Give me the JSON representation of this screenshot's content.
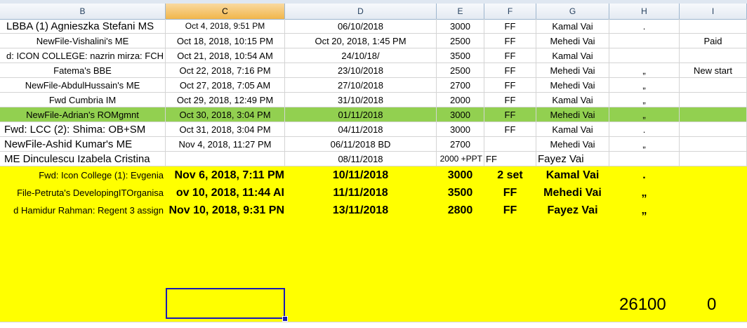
{
  "columns": [
    {
      "letter": "B",
      "active": false
    },
    {
      "letter": "C",
      "active": true
    },
    {
      "letter": "D",
      "active": false
    },
    {
      "letter": "E",
      "active": false
    },
    {
      "letter": "F",
      "active": false
    },
    {
      "letter": "G",
      "active": false
    },
    {
      "letter": "H",
      "active": false
    },
    {
      "letter": "I",
      "active": false
    }
  ],
  "rows": [
    {
      "b": "LBBA (1) Agnieszka Stefani MS",
      "c": "Oct 4, 2018, 9:51 PM",
      "d": "06/10/2018",
      "e": "3000",
      "f": "FF",
      "g": "Kamal Vai",
      "h": ".",
      "i": ""
    },
    {
      "b": "NewFile-Vishalini's ME",
      "c": "Oct 18, 2018, 10:15 PM",
      "d": "Oct 20, 2018, 1:45 PM",
      "e": "2500",
      "f": "FF",
      "g": "Mehedi Vai",
      "h": "",
      "i": "Paid"
    },
    {
      "b": "d: ICON COLLEGE: nazrin mirza: FCH",
      "c": "Oct 21, 2018, 10:54 AM",
      "d": "24/10/18/",
      "e": "3500",
      "f": "FF",
      "g": "Kamal Vai",
      "h": "",
      "i": ""
    },
    {
      "b": "Fatema's BBE",
      "c": "Oct 22, 2018, 7:16 PM",
      "d": "23/10/2018",
      "e": "2500",
      "f": "FF",
      "g": "Mehedi Vai",
      "h": "„",
      "i": "New start"
    },
    {
      "b": "NewFile-AbdulHussain's ME",
      "c": "Oct 27, 2018, 7:05 AM",
      "d": "27/10/2018",
      "e": "2700",
      "f": "FF",
      "g": "Mehedi Vai",
      "h": "„",
      "i": ""
    },
    {
      "b": "Fwd Cumbria IM",
      "c": "Oct 29, 2018, 12:49 PM",
      "d": "31/10/2018",
      "e": "2000",
      "f": "FF",
      "g": "Kamal Vai",
      "h": "„",
      "i": ""
    },
    {
      "b": "NewFile-Adrian's ROMgmnt",
      "c": "Oct 30, 2018, 3:04 PM",
      "d": "01/11/2018",
      "e": "3000",
      "f": "FF",
      "g": "Mehedi Vai",
      "h": "„",
      "i": ""
    },
    {
      "b": "Fwd: LCC (2): Shima: OB+SM",
      "c": "Oct 31, 2018, 3:04 PM",
      "d": "04/11/2018",
      "e": "3000",
      "f": "FF",
      "g": "Kamal Vai",
      "h": ".",
      "i": ""
    },
    {
      "b": "NewFile-Ashid Kumar's ME",
      "c": "Nov 4, 2018, 11:27 PM",
      "d": "06/11/2018 BD",
      "e": "2700",
      "f": "",
      "g": "Mehedi Vai",
      "h": "„",
      "i": ""
    },
    {
      "b": "ME Dinculescu Izabela Cristina",
      "c": "",
      "d": "08/11/2018",
      "e": "2000 +PPT",
      "f": "FF",
      "g": "Fayez Vai",
      "h": "",
      "i": ""
    }
  ],
  "yellow_rows": [
    {
      "b": "Fwd: Icon College (1): Evgenia",
      "c": "Nov 6, 2018, 7:11 PM",
      "d": "10/11/2018",
      "e": "3000",
      "f": "2 set",
      "g": "Kamal Vai",
      "h": "."
    },
    {
      "b": "File-Petruta's DevelopingITOrganisa",
      "c": "ov 10, 2018, 11:44 AI",
      "d": "11/11/2018",
      "e": "3500",
      "f": "FF",
      "g": "Mehedi Vai",
      "h": "„"
    },
    {
      "b": "d Hamidur Rahman: Regent 3 assign",
      "c": "Nov 10, 2018, 9:31 PN",
      "d": "13/11/2018",
      "e": "2800",
      "f": "FF",
      "g": "Fayez Vai",
      "h": "„"
    }
  ],
  "totals": {
    "sum": "26100",
    "other": "0"
  },
  "colors": {
    "highlight_row": "#92d050",
    "yellow": "#ffff00",
    "selection": "#1a1ab4"
  }
}
